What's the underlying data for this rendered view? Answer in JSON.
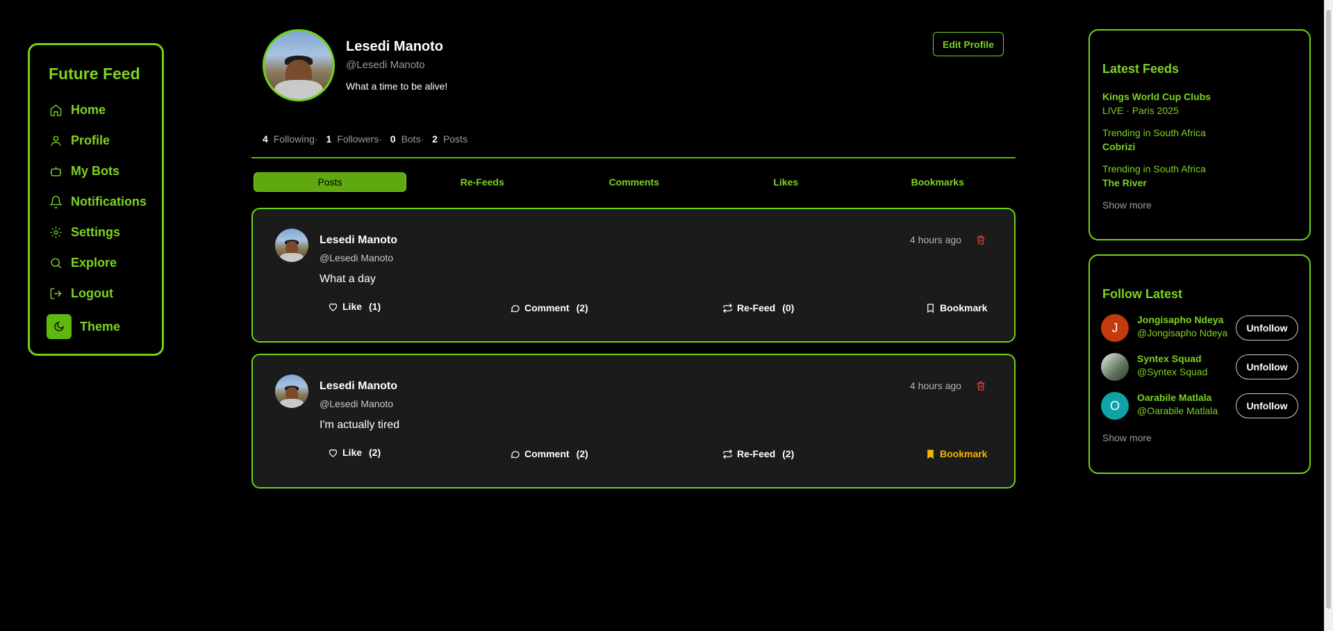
{
  "sidebar": {
    "brand": "Future Feed",
    "items": [
      {
        "label": "Home",
        "icon": "home-icon"
      },
      {
        "label": "Profile",
        "icon": "user-icon"
      },
      {
        "label": "My Bots",
        "icon": "bot-icon"
      },
      {
        "label": "Notifications",
        "icon": "bell-icon"
      },
      {
        "label": "Settings",
        "icon": "gear-icon"
      },
      {
        "label": "Explore",
        "icon": "search-icon"
      },
      {
        "label": "Logout",
        "icon": "logout-icon"
      }
    ],
    "theme_label": "Theme"
  },
  "profile": {
    "name": "Lesedi Manoto",
    "handle": "@Lesedi Manoto",
    "bio": "What a time to be alive!",
    "edit_label": "Edit Profile",
    "stats": {
      "following_count": "4",
      "following_label": "Following",
      "followers_count": "1",
      "followers_label": "Followers",
      "bots_count": "0",
      "bots_label": "Bots",
      "posts_count": "2",
      "posts_label": "Posts",
      "sep": "·"
    }
  },
  "tabs": [
    "Posts",
    "Re-Feeds",
    "Comments",
    "Likes",
    "Bookmarks"
  ],
  "posts": [
    {
      "name": "Lesedi Manoto",
      "handle": "@Lesedi Manoto",
      "text": "What a day",
      "time": "4 hours ago",
      "like_label": "Like",
      "like_count": "(1)",
      "comment_label": "Comment",
      "comment_count": "(2)",
      "refeed_label": "Re-Feed",
      "refeed_count": "(0)",
      "bookmark_label": "Bookmark",
      "bookmarked": false
    },
    {
      "name": "Lesedi Manoto",
      "handle": "@Lesedi Manoto",
      "text": "I'm actually tired",
      "time": "4 hours ago",
      "like_label": "Like",
      "like_count": "(2)",
      "comment_label": "Comment",
      "comment_count": "(2)",
      "refeed_label": "Re-Feed",
      "refeed_count": "(2)",
      "bookmark_label": "Bookmark",
      "bookmarked": true
    }
  ],
  "latest_feeds": {
    "title": "Latest Feeds",
    "items": [
      {
        "line1": "Kings World Cup Clubs",
        "line2": "LIVE · Paris 2025"
      },
      {
        "line1": "Trending in South Africa",
        "line2": "Cobrizi"
      },
      {
        "line1": "Trending in South Africa",
        "line2": "The River"
      }
    ],
    "show_more": "Show more"
  },
  "follow_latest": {
    "title": "Follow Latest",
    "users": [
      {
        "name": "Jongisapho Ndeya",
        "handle": "@Jongisapho Ndeya",
        "initial": "J",
        "color": "#c23a0e",
        "button": "Unfollow"
      },
      {
        "name": "Syntex Squad",
        "handle": "@Syntex Squad",
        "initial": "",
        "color": "#6b7f6b",
        "button": "Unfollow"
      },
      {
        "name": "Oarabile Matlala",
        "handle": "@Oarabile Matlala",
        "initial": "O",
        "color": "#0fa3a8",
        "button": "Unfollow"
      }
    ],
    "show_more": "Show more"
  },
  "colors": {
    "accent": "#7ed321",
    "danger": "#e53935",
    "bookmark": "#f4b400"
  }
}
